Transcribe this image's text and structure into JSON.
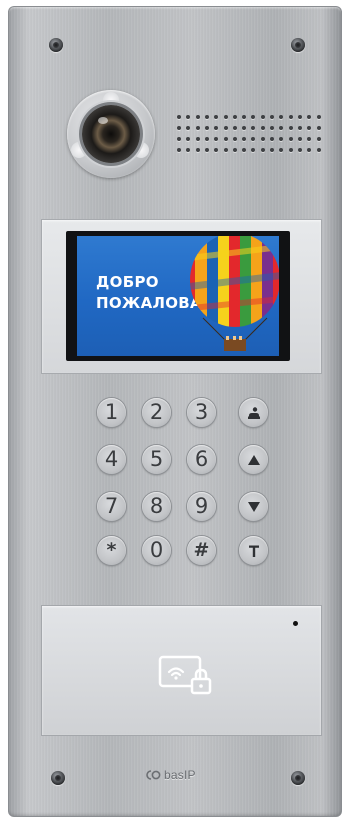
{
  "screen": {
    "welcome_line1": "ДОБРО",
    "welcome_line2": "ПОЖАЛОВАТЬ"
  },
  "keypad": {
    "keys": [
      {
        "label": "1"
      },
      {
        "label": "2"
      },
      {
        "label": "3"
      },
      {
        "icon": "concierge-icon"
      },
      {
        "label": "4"
      },
      {
        "label": "5"
      },
      {
        "label": "6"
      },
      {
        "icon": "arrow-up-icon"
      },
      {
        "label": "7"
      },
      {
        "label": "8"
      },
      {
        "label": "9"
      },
      {
        "icon": "arrow-down-icon"
      },
      {
        "label": "*"
      },
      {
        "label": "0"
      },
      {
        "label": "#"
      },
      {
        "icon": "key-t-icon"
      }
    ]
  },
  "reader": {
    "icon": "rfid-card-lock-icon"
  },
  "brand": {
    "logo_text": "basIP"
  },
  "colors": {
    "panel": "#b7babd",
    "screen": "#2a70c8",
    "key": "#c6c8cb"
  }
}
